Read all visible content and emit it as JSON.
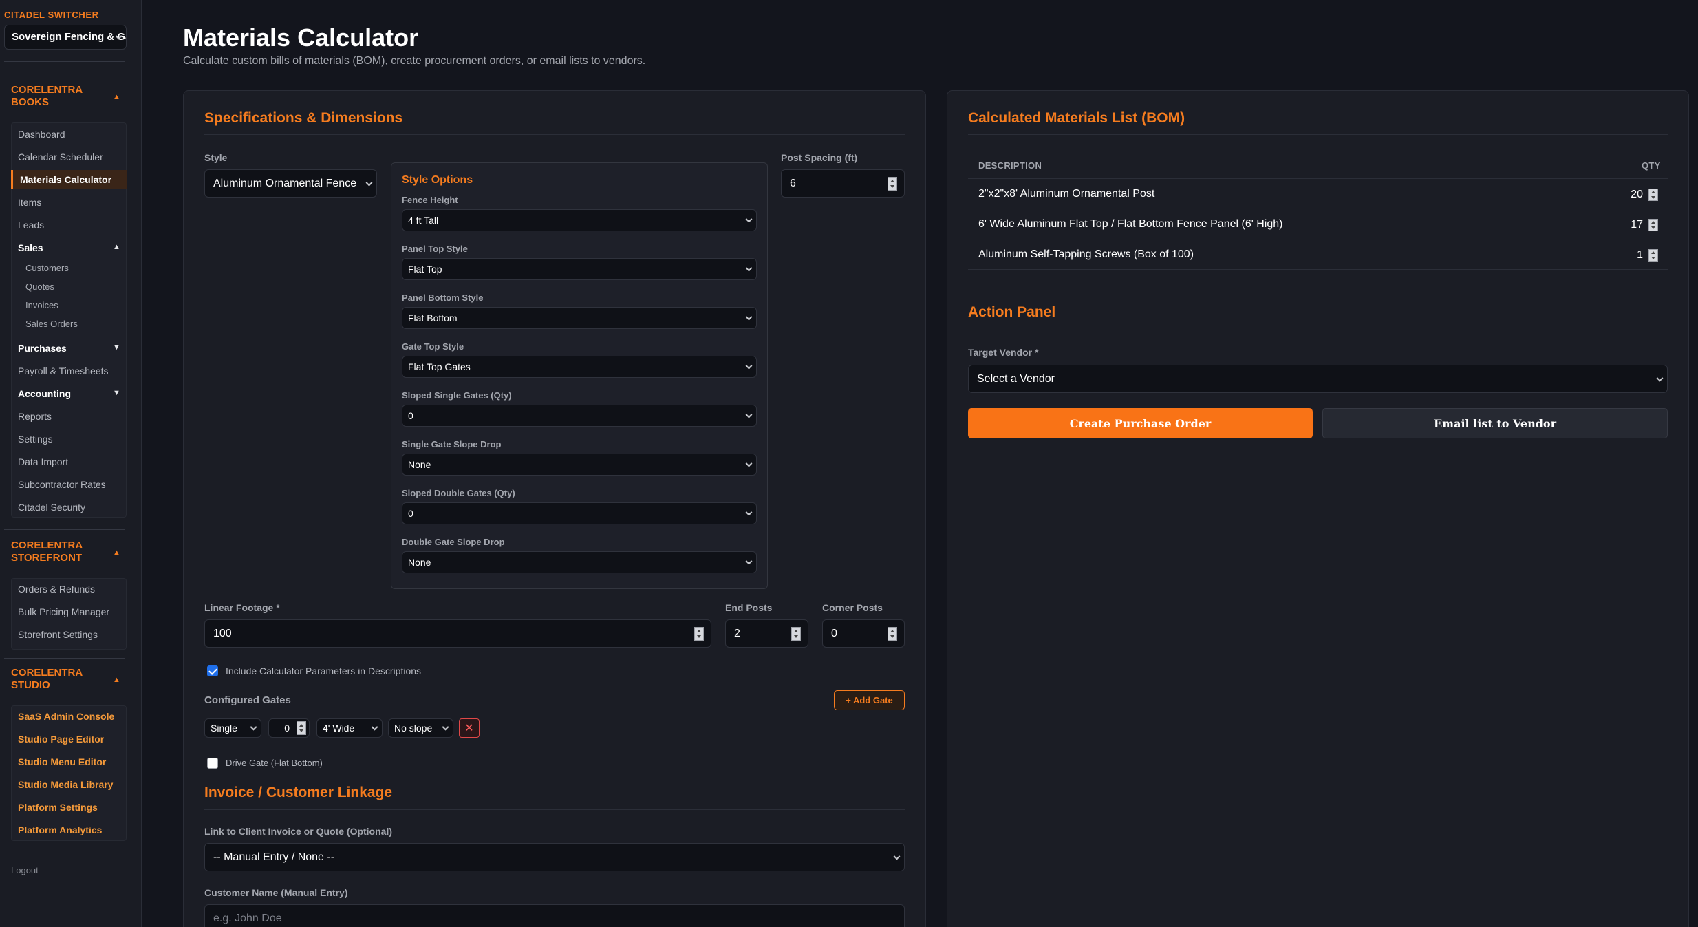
{
  "sidebar": {
    "switcher_label": "CITADEL SWITCHER",
    "switcher_value": "Sovereign Fencing & Ga",
    "books": {
      "title": "CORELENTRA BOOKS",
      "items": [
        "Dashboard",
        "Calendar Scheduler",
        "Materials Calculator",
        "Items",
        "Leads"
      ],
      "sales": {
        "label": "Sales",
        "items": [
          "Customers",
          "Quotes",
          "Invoices",
          "Sales Orders"
        ]
      },
      "purchases": "Purchases",
      "payroll": "Payroll & Timesheets",
      "accounting": "Accounting",
      "rest": [
        "Reports",
        "Settings",
        "Data Import",
        "Subcontractor Rates",
        "Citadel Security"
      ]
    },
    "storefront": {
      "title": "CORELENTRA STOREFRONT",
      "items": [
        "Orders & Refunds",
        "Bulk Pricing Manager",
        "Storefront Settings"
      ]
    },
    "studio": {
      "title": "CORELENTRA STUDIO",
      "items": [
        "SaaS Admin Console",
        "Studio Page Editor",
        "Studio Menu Editor",
        "Studio Media Library",
        "Platform Settings",
        "Platform Analytics"
      ]
    },
    "logout": "Logout"
  },
  "header": {
    "title": "Materials Calculator",
    "subtitle": "Calculate custom bills of materials (BOM), create procurement orders, or email lists to vendors."
  },
  "specs": {
    "title": "Specifications & Dimensions",
    "style_label": "Style",
    "style_value": "Aluminum Ornamental Fence",
    "post_spacing_label": "Post Spacing (ft)",
    "post_spacing_value": "6",
    "style_options": {
      "title": "Style Options",
      "fields": [
        {
          "label": "Fence Height",
          "value": "4 ft Tall"
        },
        {
          "label": "Panel Top Style",
          "value": "Flat Top"
        },
        {
          "label": "Panel Bottom Style",
          "value": "Flat Bottom"
        },
        {
          "label": "Gate Top Style",
          "value": "Flat Top Gates"
        },
        {
          "label": "Sloped Single Gates (Qty)",
          "value": "0"
        },
        {
          "label": "Single Gate Slope Drop",
          "value": "None"
        },
        {
          "label": "Sloped Double Gates (Qty)",
          "value": "0"
        },
        {
          "label": "Double Gate Slope Drop",
          "value": "None"
        }
      ]
    },
    "linear_footage_label": "Linear Footage *",
    "linear_footage_value": "100",
    "end_posts_label": "End Posts",
    "end_posts_value": "2",
    "corner_posts_label": "Corner Posts",
    "corner_posts_value": "0",
    "include_params_label": "Include Calculator Parameters in Descriptions",
    "include_params_checked": true,
    "configured_gates_label": "Configured Gates",
    "add_gate_label": "+ Add Gate",
    "gate": {
      "type": "Single",
      "qty": "0",
      "width": "4' Wide",
      "slope": "No slope",
      "remove": "✕"
    },
    "drive_gate_label": "Drive Gate (Flat Bottom)",
    "drive_gate_checked": false
  },
  "linkage": {
    "title": "Invoice / Customer Linkage",
    "link_label": "Link to Client Invoice or Quote (Optional)",
    "link_value": "-- Manual Entry / None --",
    "customer_label": "Customer Name (Manual Entry)",
    "customer_placeholder": "e.g. John Doe"
  },
  "bom": {
    "title": "Calculated Materials List (BOM)",
    "col_description": "DESCRIPTION",
    "col_qty": "QTY",
    "rows": [
      {
        "description": "2\"x2\"x8' Aluminum Ornamental Post",
        "qty": "20"
      },
      {
        "description": "6' Wide Aluminum Flat Top / Flat Bottom Fence Panel (6' High)",
        "qty": "17"
      },
      {
        "description": "Aluminum Self-Tapping Screws (Box of 100)",
        "qty": "1"
      }
    ]
  },
  "action": {
    "title": "Action Panel",
    "vendor_label": "Target Vendor *",
    "vendor_value": "Select a Vendor",
    "create_po": "Create Purchase Order",
    "email_vendor": "Email list to Vendor"
  },
  "colors": {
    "accent": "#f57c1f",
    "background": "#13151d",
    "panel": "#1b1d25"
  }
}
